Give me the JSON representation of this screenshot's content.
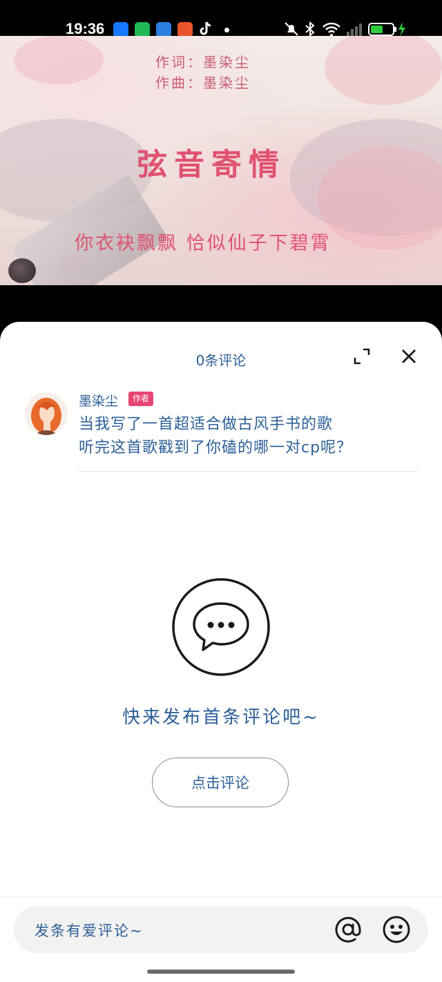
{
  "status_bar": {
    "time": "19:36"
  },
  "video": {
    "credit_lyrics": "作词：墨染尘",
    "credit_music": "作曲：墨染尘",
    "title": "弦音寄情",
    "lyric": "你衣袂飘飘 恰似仙子下碧霄"
  },
  "comments": {
    "header_title": "0条评论",
    "author": {
      "name": "墨染尘",
      "badge": "作者"
    },
    "post_lines": [
      "当我写了一首超适合做古风手书的歌",
      "听完这首歌戳到了你磕的哪一对cp呢？"
    ],
    "empty_text": "快来发布首条评论吧~",
    "comment_button": "点击评论",
    "input_placeholder": "发条有爱评论~"
  },
  "colors": {
    "accent_text": "#2c5f97",
    "badge": "#e64674",
    "title_pink": "#e0526f"
  }
}
